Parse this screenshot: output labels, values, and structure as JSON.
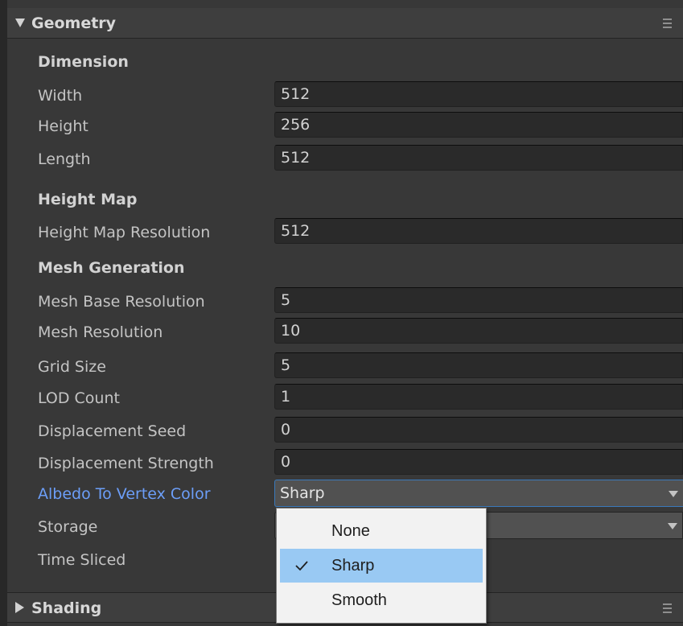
{
  "sections": {
    "geometry": {
      "title": "Geometry"
    },
    "shading": {
      "title": "Shading"
    }
  },
  "groups": {
    "dimension": "Dimension",
    "height_map": "Height Map",
    "mesh_generation": "Mesh Generation"
  },
  "fields": {
    "width": {
      "label": "Width",
      "value": "512"
    },
    "height": {
      "label": "Height",
      "value": "256"
    },
    "length": {
      "label": "Length",
      "value": "512"
    },
    "height_map_resolution": {
      "label": "Height Map Resolution",
      "value": "512"
    },
    "mesh_base_resolution": {
      "label": "Mesh Base Resolution",
      "value": "5"
    },
    "mesh_resolution": {
      "label": "Mesh Resolution",
      "value": "10"
    },
    "grid_size": {
      "label": "Grid Size",
      "value": "5"
    },
    "lod_count": {
      "label": "LOD Count",
      "value": "1"
    },
    "displacement_seed": {
      "label": "Displacement Seed",
      "value": "0"
    },
    "displacement_strength": {
      "label": "Displacement Strength",
      "value": "0"
    },
    "albedo_to_vertex_color": {
      "label": "Albedo To Vertex Color",
      "value": "Sharp"
    },
    "storage": {
      "label": "Storage",
      "value": ""
    },
    "time_sliced": {
      "label": "Time Sliced"
    }
  },
  "popup": {
    "options": [
      "None",
      "Sharp",
      "Smooth"
    ],
    "selected": "Sharp"
  },
  "colors": {
    "background": "#383838",
    "field_bg": "#2a2a2a",
    "active_label": "#6c9ef8",
    "popup_bg": "#f2f2f2",
    "popup_selected": "#99c9f3",
    "focus_border": "#3a79bb"
  },
  "icons": {
    "foldout_expanded": "triangle-down-icon",
    "foldout_collapsed": "triangle-right-icon",
    "section_menu": "menu-icon",
    "dropdown_arrow": "chevron-down-icon",
    "selected_check": "checkmark-icon"
  }
}
